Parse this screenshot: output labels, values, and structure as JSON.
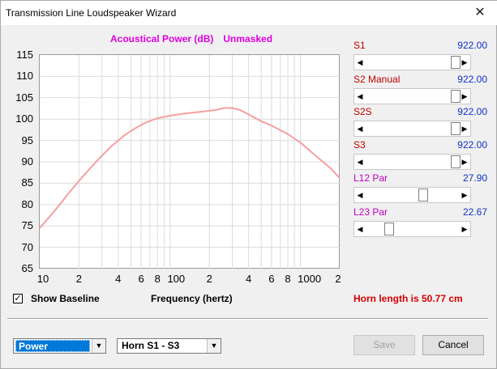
{
  "window": {
    "title": "Transmission Line Loudspeaker Wizard",
    "close_icon": "close-icon"
  },
  "chart": {
    "title_left": "Acoustical Power (dB)",
    "title_right": "Unmasked"
  },
  "chart_data": {
    "type": "line",
    "title": "Acoustical Power (dB)",
    "xlabel": "Frequency (hertz)",
    "ylabel": "",
    "xscale": "log",
    "xlim": [
      10,
      2000
    ],
    "ylim": [
      65,
      115
    ],
    "ytick_labels": [
      "115",
      "110",
      "105",
      "100",
      "95",
      "90",
      "85",
      "80",
      "75",
      "70",
      "65"
    ],
    "xtick_labels": [
      "10",
      "2",
      "4",
      "6",
      "8",
      "100",
      "2",
      "4",
      "6",
      "8",
      "1000",
      "2"
    ],
    "grid": true,
    "series": [
      {
        "color": "#f4a0a0",
        "x": [
          10,
          13,
          17,
          22,
          28,
          35,
          45,
          55,
          65,
          80,
          100,
          130,
          170,
          220,
          260,
          300,
          340,
          400,
          500,
          600,
          800,
          1000,
          1300,
          1700,
          2000
        ],
        "y": [
          74.5,
          78.5,
          83,
          87,
          90.5,
          93.5,
          96.3,
          98,
          99.2,
          100.2,
          100.8,
          101.3,
          101.7,
          102.1,
          102.6,
          102.6,
          102.2,
          101.1,
          99.5,
          98.5,
          96.5,
          94.5,
          91.5,
          88.5,
          86.2
        ]
      }
    ]
  },
  "baseline": {
    "label": "Show Baseline",
    "checked_mark": "✓"
  },
  "horn_text": "Horn length is 50.77 cm",
  "params": [
    {
      "label": "S1",
      "value": "922.00",
      "fraction": 1.0,
      "label_color": "red"
    },
    {
      "label": "S2  Manual",
      "value": "922.00",
      "fraction": 1.0,
      "label_color": "red"
    },
    {
      "label": "S2S",
      "value": "922.00",
      "fraction": 1.0,
      "label_color": "red"
    },
    {
      "label": "S3",
      "value": "922.00",
      "fraction": 1.0,
      "label_color": "red"
    },
    {
      "label": "L12  Par",
      "value": "27.90",
      "fraction": 0.62,
      "label_color": "magenta"
    },
    {
      "label": "L23  Par",
      "value": "22.67",
      "fraction": 0.22,
      "label_color": "magenta"
    }
  ],
  "bottom": {
    "power_select": "Power",
    "horn_select": "Horn S1 - S3",
    "save_label": "Save",
    "cancel_label": "Cancel"
  }
}
